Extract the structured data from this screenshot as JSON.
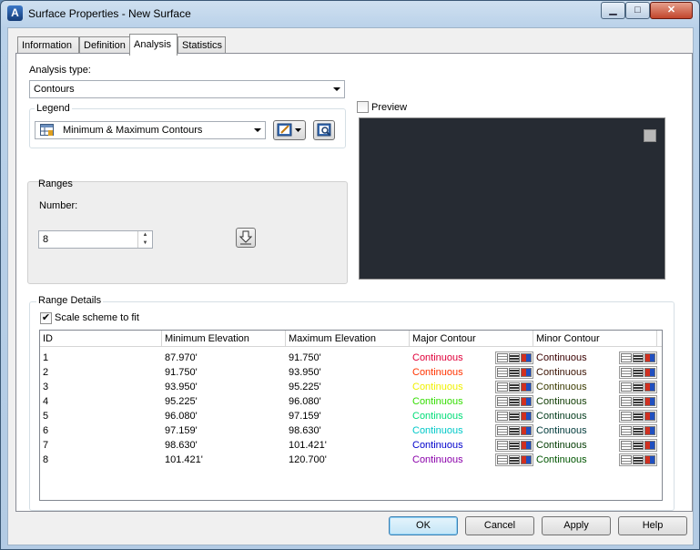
{
  "window": {
    "title": "Surface Properties - New Surface",
    "app_icon_glyph": "A",
    "controls": {
      "minimize": "▁",
      "maximize": "□",
      "close": "✕"
    }
  },
  "tabs": [
    {
      "label": "Information",
      "active": false
    },
    {
      "label": "Definition",
      "active": false
    },
    {
      "label": "Analysis",
      "active": true
    },
    {
      "label": "Statistics",
      "active": false
    }
  ],
  "analysis": {
    "analysis_type_label": "Analysis type:",
    "analysis_type_value": "Contours",
    "legend_label": "Legend",
    "legend_value": "Minimum & Maximum Contours",
    "ranges_label": "Ranges",
    "number_label": "Number:",
    "number_value": "8",
    "preview_label": "Preview",
    "preview_checked": false
  },
  "range_details": {
    "label": "Range Details",
    "scale_label": "Scale scheme to fit",
    "scale_checked": true,
    "columns": [
      "ID",
      "Minimum Elevation",
      "Maximum Elevation",
      "Major Contour",
      "Minor Contour"
    ],
    "rows": [
      {
        "id": "1",
        "min": "87.970'",
        "max": "91.750'",
        "major": "Continuous",
        "major_color": "#e0003a",
        "minor": "Continuous",
        "minor_color": "#3a0000"
      },
      {
        "id": "2",
        "min": "91.750'",
        "max": "93.950'",
        "major": "Continuous",
        "major_color": "#ff3300",
        "minor": "Continuous",
        "minor_color": "#3a1100"
      },
      {
        "id": "3",
        "min": "93.950'",
        "max": "95.225'",
        "major": "Continuous",
        "major_color": "#f0f000",
        "minor": "Continuous",
        "minor_color": "#3a3a00"
      },
      {
        "id": "4",
        "min": "95.225'",
        "max": "96.080'",
        "major": "Continuous",
        "major_color": "#33dd00",
        "minor": "Continuous",
        "minor_color": "#0d3a00"
      },
      {
        "id": "5",
        "min": "96.080'",
        "max": "97.159'",
        "major": "Continuous",
        "major_color": "#00dd77",
        "minor": "Continuous",
        "minor_color": "#003a1a"
      },
      {
        "id": "6",
        "min": "97.159'",
        "max": "98.630'",
        "major": "Continuous",
        "major_color": "#00c8c8",
        "minor": "Continuous",
        "minor_color": "#003a3a"
      },
      {
        "id": "7",
        "min": "98.630'",
        "max": "101.421'",
        "major": "Continuous",
        "major_color": "#0000cc",
        "minor": "Continuous",
        "minor_color": "#003a00"
      },
      {
        "id": "8",
        "min": "101.421'",
        "max": "120.700'",
        "major": "Continuous",
        "major_color": "#8a00aa",
        "minor": "Continuous",
        "minor_color": "#005500"
      }
    ]
  },
  "buttons": {
    "ok": "OK",
    "cancel": "Cancel",
    "apply": "Apply",
    "help": "Help"
  }
}
